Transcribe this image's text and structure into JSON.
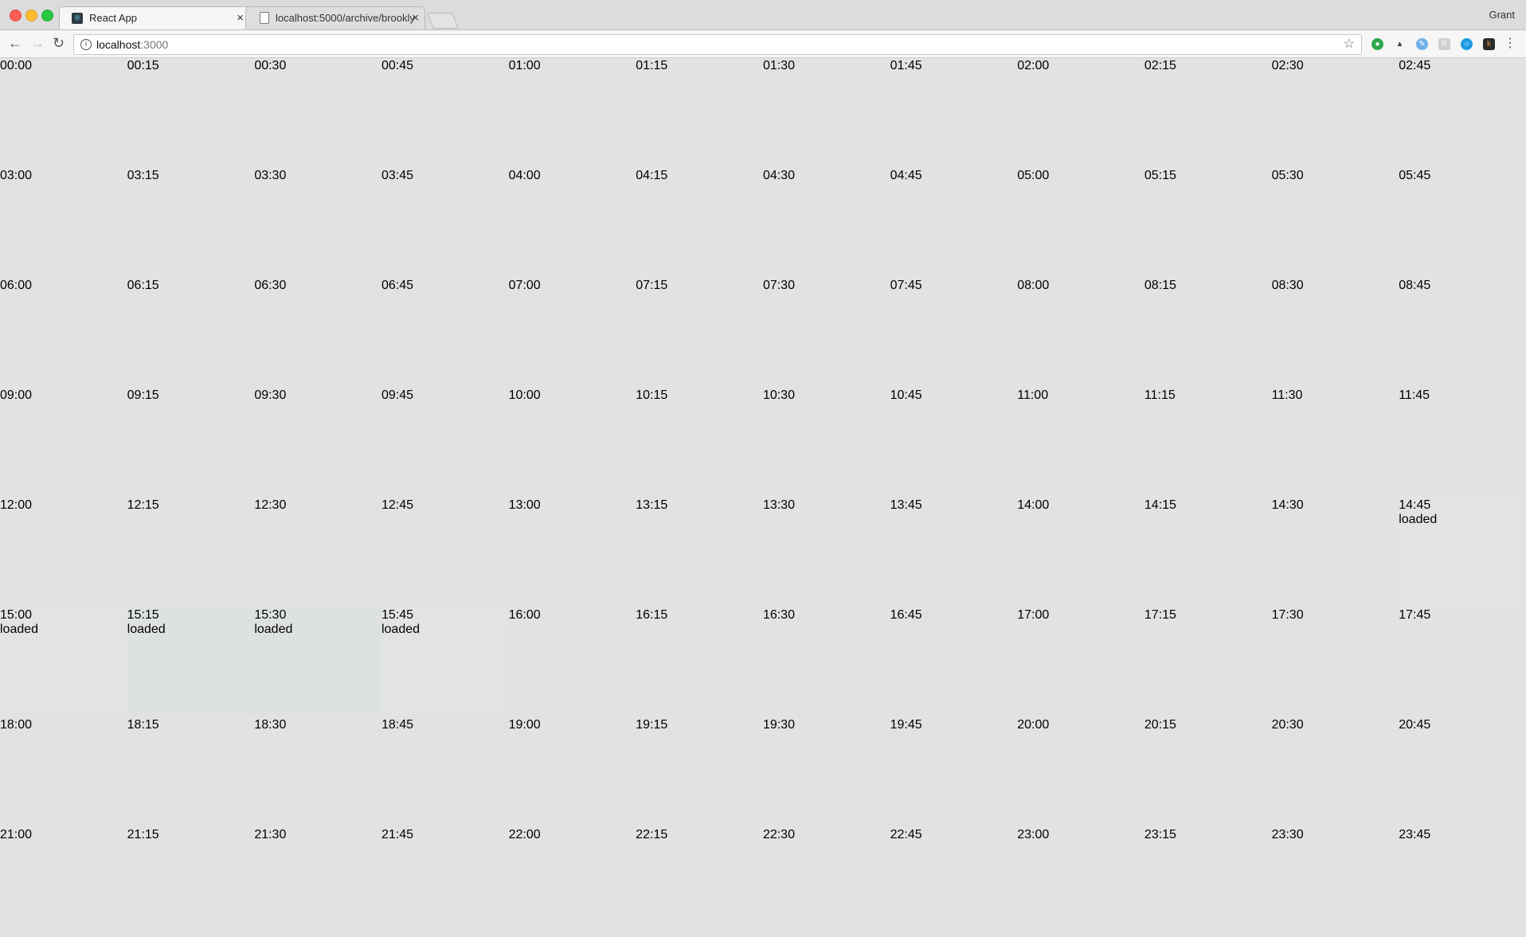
{
  "browser": {
    "tabs": [
      {
        "title": "React App",
        "active": true,
        "icon": "react-icon"
      },
      {
        "title": "localhost:5000/archive/brookly",
        "active": false,
        "icon": "document-icon"
      }
    ],
    "profile_name": "Grant",
    "url_host": "localhost",
    "url_port": ":3000",
    "extensions": [
      {
        "icon": "green-circle-icon",
        "color": "#2fa84f"
      },
      {
        "icon": "cow-icon",
        "color": "#444444"
      },
      {
        "icon": "feather-icon",
        "color": "#6fb1e8"
      },
      {
        "icon": "r-box-icon",
        "color": "#cfcfcf"
      },
      {
        "icon": "blue-ring-icon",
        "color": "#1e9be0"
      },
      {
        "icon": "k-icon",
        "color": "#d89b2a"
      }
    ]
  },
  "page": {
    "slots": [
      {
        "time": "00:00",
        "status": ""
      },
      {
        "time": "00:15",
        "status": ""
      },
      {
        "time": "00:30",
        "status": ""
      },
      {
        "time": "00:45",
        "status": ""
      },
      {
        "time": "01:00",
        "status": ""
      },
      {
        "time": "01:15",
        "status": ""
      },
      {
        "time": "01:30",
        "status": ""
      },
      {
        "time": "01:45",
        "status": ""
      },
      {
        "time": "02:00",
        "status": ""
      },
      {
        "time": "02:15",
        "status": ""
      },
      {
        "time": "02:30",
        "status": ""
      },
      {
        "time": "02:45",
        "status": ""
      },
      {
        "time": "03:00",
        "status": ""
      },
      {
        "time": "03:15",
        "status": ""
      },
      {
        "time": "03:30",
        "status": ""
      },
      {
        "time": "03:45",
        "status": ""
      },
      {
        "time": "04:00",
        "status": ""
      },
      {
        "time": "04:15",
        "status": ""
      },
      {
        "time": "04:30",
        "status": ""
      },
      {
        "time": "04:45",
        "status": ""
      },
      {
        "time": "05:00",
        "status": ""
      },
      {
        "time": "05:15",
        "status": ""
      },
      {
        "time": "05:30",
        "status": ""
      },
      {
        "time": "05:45",
        "status": ""
      },
      {
        "time": "06:00",
        "status": ""
      },
      {
        "time": "06:15",
        "status": ""
      },
      {
        "time": "06:30",
        "status": ""
      },
      {
        "time": "06:45",
        "status": ""
      },
      {
        "time": "07:00",
        "status": ""
      },
      {
        "time": "07:15",
        "status": ""
      },
      {
        "time": "07:30",
        "status": ""
      },
      {
        "time": "07:45",
        "status": ""
      },
      {
        "time": "08:00",
        "status": ""
      },
      {
        "time": "08:15",
        "status": ""
      },
      {
        "time": "08:30",
        "status": ""
      },
      {
        "time": "08:45",
        "status": ""
      },
      {
        "time": "09:00",
        "status": ""
      },
      {
        "time": "09:15",
        "status": ""
      },
      {
        "time": "09:30",
        "status": ""
      },
      {
        "time": "09:45",
        "status": ""
      },
      {
        "time": "10:00",
        "status": ""
      },
      {
        "time": "10:15",
        "status": ""
      },
      {
        "time": "10:30",
        "status": ""
      },
      {
        "time": "10:45",
        "status": ""
      },
      {
        "time": "11:00",
        "status": ""
      },
      {
        "time": "11:15",
        "status": ""
      },
      {
        "time": "11:30",
        "status": ""
      },
      {
        "time": "11:45",
        "status": ""
      },
      {
        "time": "12:00",
        "status": ""
      },
      {
        "time": "12:15",
        "status": ""
      },
      {
        "time": "12:30",
        "status": ""
      },
      {
        "time": "12:45",
        "status": ""
      },
      {
        "time": "13:00",
        "status": ""
      },
      {
        "time": "13:15",
        "status": ""
      },
      {
        "time": "13:30",
        "status": ""
      },
      {
        "time": "13:45",
        "status": ""
      },
      {
        "time": "14:00",
        "status": ""
      },
      {
        "time": "14:15",
        "status": ""
      },
      {
        "time": "14:30",
        "status": ""
      },
      {
        "time": "14:45",
        "status": "loaded"
      },
      {
        "time": "15:00",
        "status": "loaded"
      },
      {
        "time": "15:15",
        "status": "loaded"
      },
      {
        "time": "15:30",
        "status": "loaded"
      },
      {
        "time": "15:45",
        "status": "loaded"
      },
      {
        "time": "16:00",
        "status": ""
      },
      {
        "time": "16:15",
        "status": ""
      },
      {
        "time": "16:30",
        "status": ""
      },
      {
        "time": "16:45",
        "status": ""
      },
      {
        "time": "17:00",
        "status": ""
      },
      {
        "time": "17:15",
        "status": ""
      },
      {
        "time": "17:30",
        "status": ""
      },
      {
        "time": "17:45",
        "status": ""
      },
      {
        "time": "18:00",
        "status": ""
      },
      {
        "time": "18:15",
        "status": ""
      },
      {
        "time": "18:30",
        "status": ""
      },
      {
        "time": "18:45",
        "status": ""
      },
      {
        "time": "19:00",
        "status": ""
      },
      {
        "time": "19:15",
        "status": ""
      },
      {
        "time": "19:30",
        "status": ""
      },
      {
        "time": "19:45",
        "status": ""
      },
      {
        "time": "20:00",
        "status": ""
      },
      {
        "time": "20:15",
        "status": ""
      },
      {
        "time": "20:30",
        "status": ""
      },
      {
        "time": "20:45",
        "status": ""
      },
      {
        "time": "21:00",
        "status": ""
      },
      {
        "time": "21:15",
        "status": ""
      },
      {
        "time": "21:30",
        "status": ""
      },
      {
        "time": "21:45",
        "status": ""
      },
      {
        "time": "22:00",
        "status": ""
      },
      {
        "time": "22:15",
        "status": ""
      },
      {
        "time": "22:30",
        "status": ""
      },
      {
        "time": "22:45",
        "status": ""
      },
      {
        "time": "23:00",
        "status": ""
      },
      {
        "time": "23:15",
        "status": ""
      },
      {
        "time": "23:30",
        "status": ""
      },
      {
        "time": "23:45",
        "status": ""
      }
    ],
    "colors": {
      "background": "#e1e2e1",
      "loaded_tint_a": "#e4e3e3",
      "loaded_tint_b": "#dee2df"
    }
  }
}
